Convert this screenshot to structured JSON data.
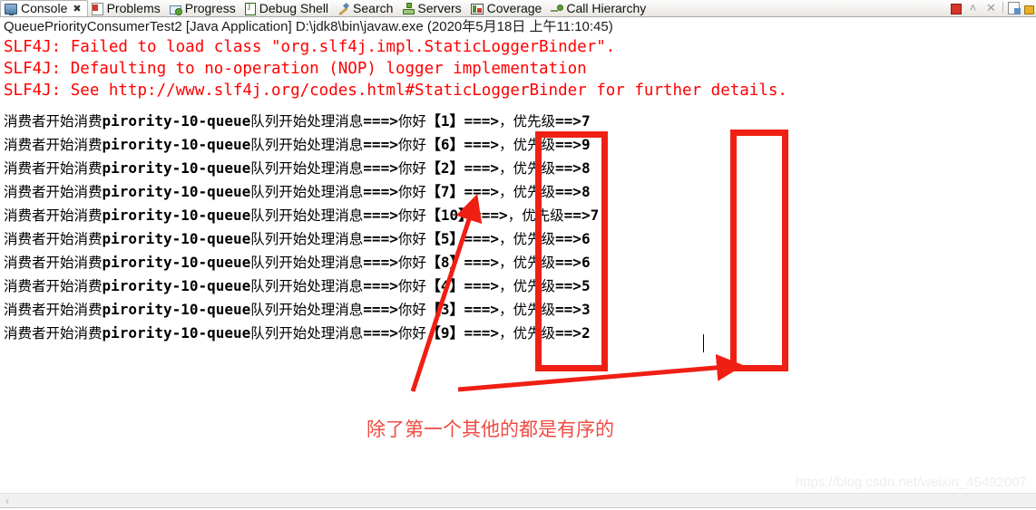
{
  "tabs": [
    {
      "label": "Console",
      "icon": "console-icon",
      "active": true,
      "closable": true
    },
    {
      "label": "Problems",
      "icon": "problems-icon",
      "active": false,
      "closable": false
    },
    {
      "label": "Progress",
      "icon": "progress-icon",
      "active": false,
      "closable": false
    },
    {
      "label": "Debug Shell",
      "icon": "debug-shell-icon",
      "active": false,
      "closable": false
    },
    {
      "label": "Search",
      "icon": "search-icon",
      "active": false,
      "closable": false
    },
    {
      "label": "Servers",
      "icon": "servers-icon",
      "active": false,
      "closable": false
    },
    {
      "label": "Coverage",
      "icon": "coverage-icon",
      "active": false,
      "closable": false
    },
    {
      "label": "Call Hierarchy",
      "icon": "call-hierarchy-icon",
      "active": false,
      "closable": false
    }
  ],
  "tab_close_glyph": "✖",
  "toolbar": {
    "terminate": "terminate-icon",
    "scroll_lock_up": "˄",
    "remove_all": "✕",
    "clear_console": "clear-console-icon",
    "pin_console": "pin-console-icon"
  },
  "console": {
    "title": "QueuePriorityConsumerTest2 [Java Application] D:\\jdk8\\bin\\javaw.exe (2020年5月18日 上午11:10:45)",
    "slf4j_lines": [
      "SLF4J: Failed to load class \"org.slf4j.impl.StaticLoggerBinder\".",
      "SLF4J: Defaulting to no-operation (NOP) logger implementation",
      "SLF4J: See http://www.slf4j.org/codes.html#StaticLoggerBinder for further details."
    ],
    "line_prefix_cjk": "消费者开始消费",
    "queue_name": "pirority-10-queue",
    "line_mid_cjk": "队列开始处理消息",
    "arrow": "===>",
    "greeting": "你好",
    "priority_label": "，优先级",
    "priority_arrow": "==>",
    "messages": [
      {
        "id": "【1】",
        "priority": "7"
      },
      {
        "id": "【6】",
        "priority": "9"
      },
      {
        "id": "【2】",
        "priority": "8"
      },
      {
        "id": "【7】",
        "priority": "8"
      },
      {
        "id": "【10】",
        "priority": "7"
      },
      {
        "id": "【5】",
        "priority": "6"
      },
      {
        "id": "【8】",
        "priority": "6"
      },
      {
        "id": "【4】",
        "priority": "5"
      },
      {
        "id": "【3】",
        "priority": "3"
      },
      {
        "id": "【9】",
        "priority": "2"
      }
    ]
  },
  "annotation": {
    "note_text": "除了第一个其他的都是有序的",
    "color": "#f01f14",
    "note_color": "#ef4b42"
  },
  "watermark": {
    "text": "https://blog.csdn.net/weixin_45492007"
  },
  "scrollbar": {
    "left_arrow": "‹"
  }
}
